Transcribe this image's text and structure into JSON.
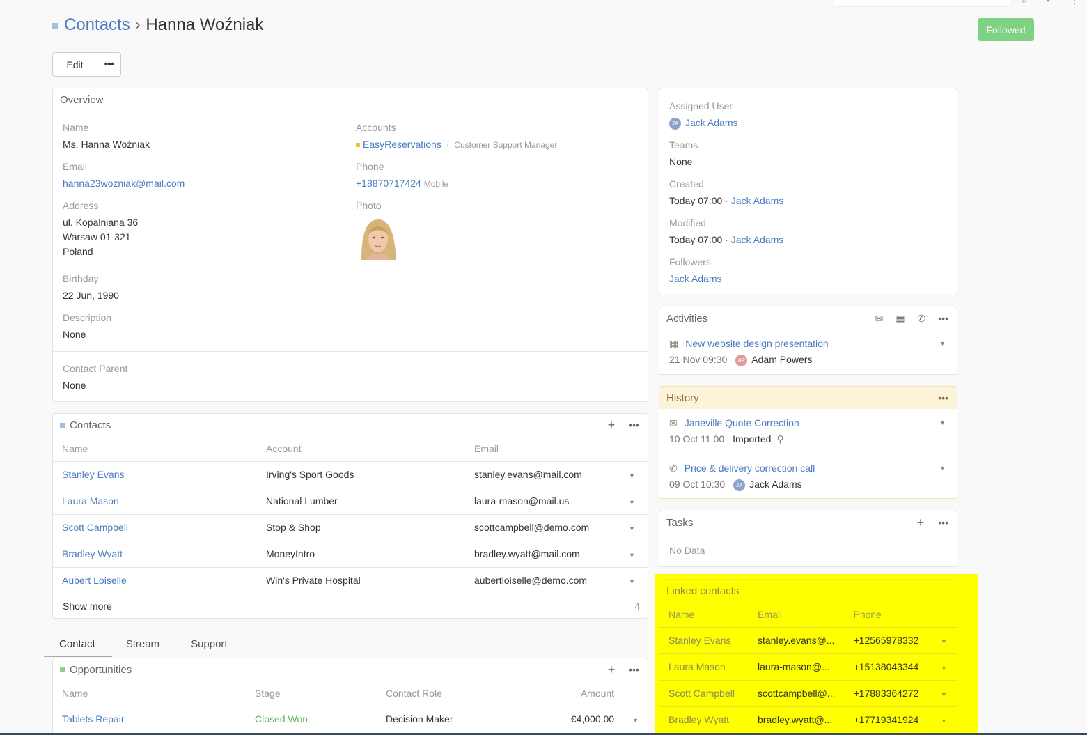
{
  "header": {
    "breadcrumb_root": "Contacts",
    "breadcrumb_sep": "›",
    "breadcrumb_current": "Hanna Woźniak",
    "followed_label": "Followed",
    "edit_label": "Edit",
    "more_label": "•••"
  },
  "overview": {
    "title": "Overview",
    "name_label": "Name",
    "name_value": "Ms. Hanna Woźniak",
    "email_label": "Email",
    "email_value": "hanna23wozniak@mail.com",
    "address_label": "Address",
    "address_line1": "ul. Kopalniana 36",
    "address_line2": "Warsaw 01-321",
    "address_line3": "Poland",
    "birthday_label": "Birthday",
    "birthday_value": "22 Jun, 1990",
    "description_label": "Description",
    "description_value": "None",
    "accounts_label": "Accounts",
    "account_name": "EasyReservations",
    "account_sep": "·",
    "account_title": "Customer Support Manager",
    "phone_label": "Phone",
    "phone_value": "+18870717424",
    "phone_type": "Mobile",
    "photo_label": "Photo",
    "contact_parent_label": "Contact Parent",
    "contact_parent_value": "None"
  },
  "contacts_panel": {
    "title": "Contacts",
    "columns": [
      "Name",
      "Account",
      "Email"
    ],
    "rows": [
      {
        "name": "Stanley Evans",
        "account": "Irving's Sport Goods",
        "email": "stanley.evans@mail.com"
      },
      {
        "name": "Laura Mason",
        "account": "National Lumber",
        "email": "laura-mason@mail.us"
      },
      {
        "name": "Scott Campbell",
        "account": "Stop & Shop",
        "email": "scottcampbell@demo.com"
      },
      {
        "name": "Bradley Wyatt",
        "account": "MoneyIntro",
        "email": "bradley.wyatt@mail.com"
      },
      {
        "name": "Aubert Loiselle",
        "account": "Win's Private Hospital",
        "email": "aubertloiselle@demo.com"
      }
    ],
    "show_more": "Show more",
    "remaining_count": "4"
  },
  "tabs": [
    "Contact",
    "Stream",
    "Support"
  ],
  "opportunities": {
    "title": "Opportunities",
    "columns": [
      "Name",
      "Stage",
      "Contact Role",
      "Amount"
    ],
    "rows": [
      {
        "name": "Tablets Repair",
        "stage": "Closed Won",
        "role": "Decision Maker",
        "amount": "€4,000.00"
      }
    ]
  },
  "side": {
    "assigned_user_label": "Assigned User",
    "assigned_user": "Jack Adams",
    "assigned_initials": "JA",
    "teams_label": "Teams",
    "teams_value": "None",
    "created_label": "Created",
    "created_value": "Today 07:00",
    "created_by": "Jack Adams",
    "modified_label": "Modified",
    "modified_value": "Today 07:00",
    "modified_by": "Jack Adams",
    "followers_label": "Followers",
    "followers_value": "Jack Adams",
    "dot": "·"
  },
  "activities": {
    "title": "Activities",
    "item_title": "New website design presentation",
    "item_date": "21 Nov 09:30",
    "item_user": "Adam Powers",
    "item_initials": "AP"
  },
  "history": {
    "title": "History",
    "items": [
      {
        "title": "Janeville Quote Correction",
        "date": "10 Oct 11:00",
        "extra": "Imported"
      },
      {
        "title": "Price & delivery correction call",
        "date": "09 Oct 10:30",
        "extra": "Jack Adams",
        "initials": "JA"
      }
    ]
  },
  "tasks": {
    "title": "Tasks",
    "empty": "No Data"
  },
  "linked_contacts": {
    "title": "Linked contacts",
    "columns": [
      "Name",
      "Email",
      "Phone"
    ],
    "rows": [
      {
        "name": "Stanley Evans",
        "email": "stanley.evans@...",
        "phone": "+12565978332"
      },
      {
        "name": "Laura Mason",
        "email": "laura-mason@...",
        "phone": "+15138043344"
      },
      {
        "name": "Scott Campbell",
        "email": "scottcampbell@...",
        "phone": "+17883364272"
      },
      {
        "name": "Bradley Wyatt",
        "email": "bradley.wyatt@...",
        "phone": "+17719341924"
      }
    ]
  },
  "colors": {
    "accent": "#4a7cc0",
    "followed": "#7fd183",
    "history_header": "#fdf3d9",
    "highlight": "#ffff00",
    "stage_won": "#5cb85c"
  }
}
